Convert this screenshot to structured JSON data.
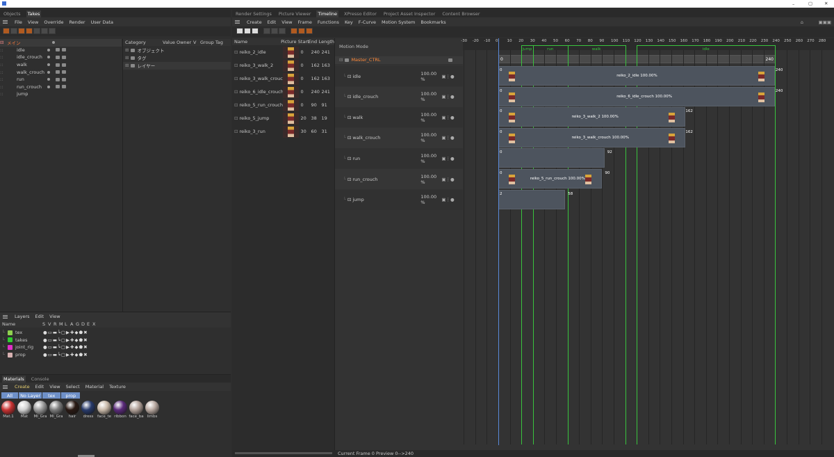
{
  "objects_panel": {
    "tabs": [
      "Objects",
      "Takes"
    ],
    "active_tab": "Takes",
    "menu": [
      "File",
      "View",
      "Override",
      "Render",
      "User Data"
    ],
    "takes": [
      {
        "label": "メイン",
        "main": true
      },
      {
        "label": "idle"
      },
      {
        "label": "idle_crouch"
      },
      {
        "label": "walk"
      },
      {
        "label": "walk_crouch"
      },
      {
        "label": "run"
      },
      {
        "label": "run_crouch"
      },
      {
        "label": "jump"
      }
    ],
    "attr_headers": [
      "Category",
      "Value",
      "Owner",
      "V",
      "Group Tag"
    ],
    "attr_rows": [
      "オブジェクト",
      "タグ",
      "レイヤー"
    ]
  },
  "layers_panel": {
    "menu": [
      "Layers",
      "Edit",
      "View"
    ],
    "headers": [
      "Name",
      "S",
      "V",
      "R",
      "M",
      "L",
      "A",
      "G",
      "D",
      "E",
      "X"
    ],
    "layers": [
      {
        "name": "tex",
        "color": "#8fd14f"
      },
      {
        "name": "takes",
        "color": "#2fcc2f"
      },
      {
        "name": "joint_rig",
        "color": "#e02fc8"
      },
      {
        "name": "prop",
        "color": "#d6b0b0"
      }
    ]
  },
  "materials_panel": {
    "tabs": [
      "Materials",
      "Console"
    ],
    "menu": [
      "Create",
      "Edit",
      "View",
      "Select",
      "Material",
      "Texture"
    ],
    "filters": [
      "All",
      "No Layer",
      "tex",
      "prop"
    ],
    "materials": [
      {
        "label": "Mat.1",
        "color": "#c83232"
      },
      {
        "label": "Mat",
        "color": "#d0d0d0"
      },
      {
        "label": "MI_Gra",
        "color": "#9a9a9a"
      },
      {
        "label": "MI_Gra",
        "color": "#7a7a7a"
      },
      {
        "label": "hair",
        "color": "#2a1a14"
      },
      {
        "label": "dress",
        "color": "#283a6a"
      },
      {
        "label": "face_te",
        "color": "#c8b8a8"
      },
      {
        "label": "ribbon",
        "color": "#5a2a7a"
      },
      {
        "label": "face_ba",
        "color": "#b0a098"
      },
      {
        "label": "limbs",
        "color": "#b8a8a0"
      }
    ]
  },
  "timeline": {
    "tabs": [
      "Render Settings",
      "Picture Viewer",
      "Timeline",
      "XPresso Editor",
      "Project Asset Inspector",
      "Content Browser"
    ],
    "active_tab": "Timeline",
    "menu": [
      "Create",
      "Edit",
      "View",
      "Frame",
      "Functions",
      "Key",
      "F-Curve",
      "Motion System",
      "Bookmarks"
    ],
    "clip_headers": [
      "Name",
      "Picture",
      "Start",
      "End",
      "Length"
    ],
    "clips": [
      {
        "name": "reiko_2_idle",
        "start": "0",
        "end": "240",
        "length": "241"
      },
      {
        "name": "reiko_3_walk_2",
        "start": "0",
        "end": "162",
        "length": "163"
      },
      {
        "name": "reiko_3_walk_crouch",
        "start": "0",
        "end": "162",
        "length": "163"
      },
      {
        "name": "reiko_6_idle_crouch",
        "start": "0",
        "end": "240",
        "length": "241"
      },
      {
        "name": "reiko_5_run_crouch",
        "start": "0",
        "end": "90",
        "length": "91"
      },
      {
        "name": "reiko_5_jump",
        "start": "20",
        "end": "38",
        "length": "19"
      },
      {
        "name": "reiko_3_run",
        "start": "30",
        "end": "60",
        "length": "31"
      }
    ],
    "motion_mode": "Motion Mode",
    "master": "Master_CTRL",
    "tracks": [
      {
        "name": "idle",
        "pct": "100.00 %",
        "start": "0",
        "end": "240",
        "clip": "reiko_2_idle  100.00%",
        "endframe": 240
      },
      {
        "name": "idle_crouch",
        "pct": "100.00 %",
        "start": "0",
        "end": "240",
        "clip": "reiko_6_idle_crouch  100.00%",
        "endframe": 240
      },
      {
        "name": "walk",
        "pct": "100.00 %",
        "start": "0",
        "end": "162",
        "clip": "reiko_3_walk_2  100.00%",
        "endframe": 162
      },
      {
        "name": "walk_crouch",
        "pct": "100.00 %",
        "start": "0",
        "end": "162",
        "clip": "reiko_3_walk_crouch  100.00%",
        "endframe": 162
      },
      {
        "name": "run",
        "pct": "100.00 %",
        "start": "0",
        "end": "92",
        "clip": "",
        "endframe": 92
      },
      {
        "name": "run_crouch",
        "pct": "100.00 %",
        "start": "0",
        "end": "90",
        "clip": "reiko_5_run_crouch  100.00%",
        "endframe": 90
      },
      {
        "name": "jump",
        "pct": "100.00 %",
        "start": "2",
        "end": "58",
        "clip": "",
        "endframe": 58
      }
    ],
    "ruler": [
      "-30",
      "-20",
      "-10",
      "0",
      "10",
      "20",
      "30",
      "40",
      "50",
      "60",
      "70",
      "80",
      "90",
      "100",
      "110",
      "120",
      "130",
      "140",
      "150",
      "160",
      "170",
      "180",
      "190",
      "200",
      "210",
      "220",
      "230",
      "240",
      "250",
      "260",
      "270",
      "280"
    ],
    "markers": [
      "jump",
      "run",
      "walk",
      "idle"
    ],
    "master_start": "0",
    "master_end": "240",
    "status": "Current Frame  0  Preview  0-->240"
  }
}
